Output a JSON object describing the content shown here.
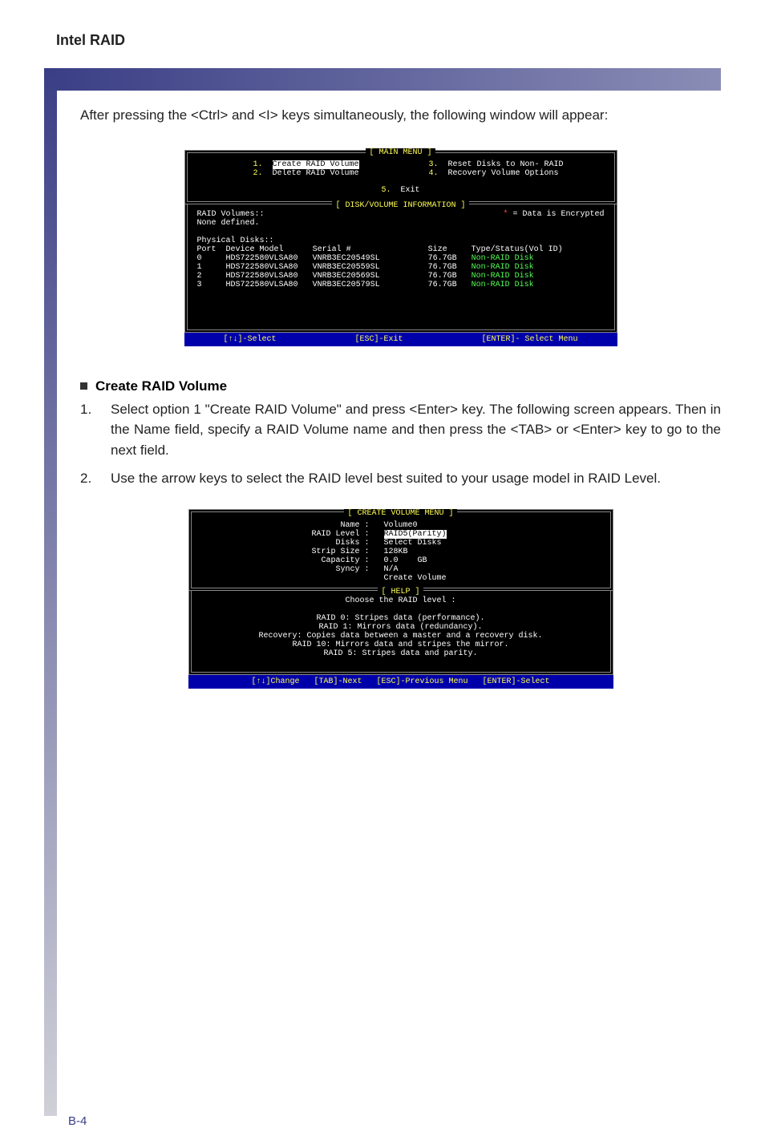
{
  "header": {
    "title": "Intel RAID"
  },
  "intro": "After pressing the <Ctrl> and <I> keys simultaneously, the following window will appear:",
  "screenshot1": {
    "main_menu_label": "[ MAIN MENU ]",
    "menu": {
      "n1": "1.",
      "i1": "Create RAID Volume",
      "n2": "2.",
      "i2": "Delete RAID Volume",
      "n3": "3.",
      "i3": "Reset Disks to Non- RAID",
      "n4": "4.",
      "i4": "Recovery Volume Options",
      "n5": "5.",
      "i5": "Exit"
    },
    "info_label": "[ DISK/VOLUME INFORMATION ]",
    "raid_vol_label": "RAID Volumes::",
    "none_defined": "None defined.",
    "encrypted_marker": "*",
    "encrypted_text": " = Data is Encrypted",
    "phys_label": "Physical Disks::",
    "cols": {
      "port": "Port",
      "model": "Device Model",
      "serial": "Serial #",
      "size": "Size",
      "type": "Type/Status(Vol ID)"
    },
    "rows": [
      {
        "port": "0",
        "model": "HDS722580VLSA80",
        "serial": "VNRB3EC20549SL",
        "size": "76.7GB",
        "type": "Non-RAID Disk"
      },
      {
        "port": "1",
        "model": "HDS722580VLSA80",
        "serial": "VNRB3EC20559SL",
        "size": "76.7GB",
        "type": "Non-RAID Disk"
      },
      {
        "port": "2",
        "model": "HDS722580VLSA80",
        "serial": "VNRB3EC20569SL",
        "size": "76.7GB",
        "type": "Non-RAID Disk"
      },
      {
        "port": "3",
        "model": "HDS722580VLSA80",
        "serial": "VNRB3EC20579SL",
        "size": "76.7GB",
        "type": "Non-RAID Disk"
      }
    ],
    "footer": {
      "select": "[↑↓]-Select",
      "exit": "[ESC]-Exit",
      "enter": "[ENTER]- Select Menu"
    }
  },
  "section": {
    "title": "Create RAID Volume"
  },
  "step1": {
    "num": "1.",
    "text": "Select option 1 \"Create RAID Volume\" and press <Enter> key. The following screen appears. Then in the Name field, specify a RAID Volume name and then press the <TAB> or <Enter> key to go to the next field."
  },
  "step2": {
    "num": "2.",
    "text": "Use the arrow keys to select the RAID level best suited to your usage model in RAID Level."
  },
  "screenshot2": {
    "menu_label": "[ CREATE VOLUME MENU ]",
    "fields": {
      "name_l": "Name :",
      "name_v": "Volume0",
      "level_l": "RAID Level :",
      "level_v": "RAID5(Parity)",
      "disks_l": "Disks :",
      "disks_v": "Select Disks",
      "strip_l": "Strip Size :",
      "strip_v": "128KB",
      "cap_l": "Capacity :",
      "cap_v": "0.0    GB",
      "sync_l": "Syncy :",
      "sync_v": "N/A",
      "create": "Create Volume"
    },
    "help_label": "[ HELP ]",
    "help_title": "Choose the RAID level :",
    "help_lines": [
      "RAID 0:  Stripes data (performance).",
      "RAID 1:  Mirrors data (redundancy).",
      "Recovery:  Copies data between a master and a recovery disk.",
      "RAID 10:  Mirrors data and stripes the mirror.",
      "RAID 5:  Stripes data and parity."
    ],
    "footer": {
      "change": "[↑↓]Change",
      "next": "[TAB]-Next",
      "prev": "[ESC]-Previous Menu",
      "sel": "[ENTER]-Select"
    }
  },
  "pagenum": "B-4"
}
